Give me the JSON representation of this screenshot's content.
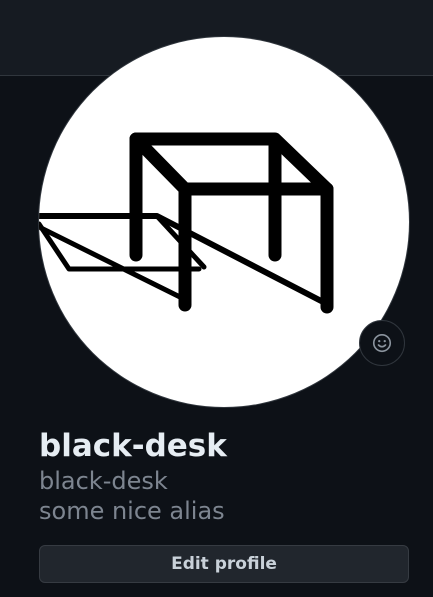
{
  "profile": {
    "full_name": "black-desk",
    "username": "black-desk",
    "alias": "some nice alias",
    "avatar_icon": "desk-drawing-icon",
    "status_icon": "smiley-icon"
  },
  "actions": {
    "edit_profile_label": "Edit profile"
  },
  "colors": {
    "background": "#0d1117",
    "header_background": "#161b22",
    "border": "#30363d",
    "primary_text": "#e6edf3",
    "secondary_text": "#7d8590",
    "button_background": "#21262d"
  }
}
